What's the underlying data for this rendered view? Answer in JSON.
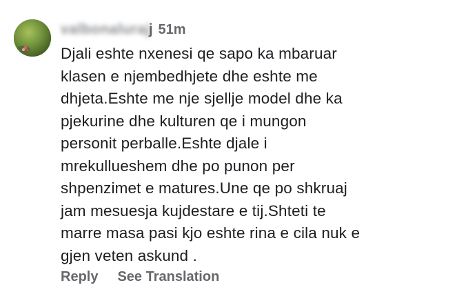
{
  "comment": {
    "author": {
      "name_visible": "j",
      "name_blurred": "valbonaluraj"
    },
    "timestamp": "51m",
    "text_lines": [
      "Djali eshte nxenesi qe sapo ka mbaruar",
      "klasen e njembedhjete dhe eshte me",
      "dhjeta.Eshte me nje sjellje model dhe ka",
      "pjekurine dhe kulturen qe i mungon",
      "personit perballe.Eshte djale i",
      "mrekullueshem dhe po punon per",
      "shpenzimet e matures.Une qe po shkruaj",
      "jam mesuesja kujdestare e tij.Shteti te",
      "marre masa pasi kjo eshte rina e cila nuk e",
      "gjen veten askund ."
    ],
    "actions": {
      "reply": "Reply",
      "translate": "See Translation"
    }
  },
  "colors": {
    "text": "#1c1e21",
    "secondary": "#65676b",
    "background": "#ffffff"
  }
}
